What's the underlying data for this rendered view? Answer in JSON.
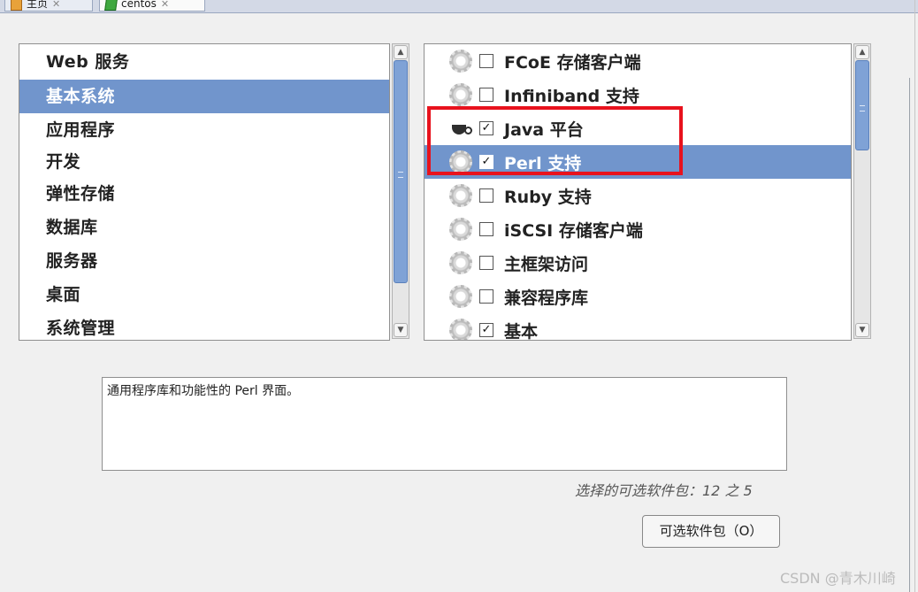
{
  "tabs": [
    {
      "label": "主页",
      "close": "✕"
    },
    {
      "label": "centos",
      "close": "✕"
    }
  ],
  "groups": [
    "Web 服务",
    "基本系统",
    "应用程序",
    "开发",
    "弹性存储",
    "数据库",
    "服务器",
    "桌面",
    "系统管理"
  ],
  "selected_group": "基本系统",
  "packages": [
    {
      "label": "FCoE 存储客户端",
      "checked": false,
      "icon": "gear-icon"
    },
    {
      "label": "Infiniband 支持",
      "checked": false,
      "icon": "gear-icon"
    },
    {
      "label": "Java 平台",
      "checked": true,
      "icon": "coffee-cup-icon"
    },
    {
      "label": "Perl 支持",
      "checked": true,
      "icon": "gear-icon",
      "selected": true
    },
    {
      "label": "Ruby 支持",
      "checked": false,
      "icon": "gear-icon"
    },
    {
      "label": "iSCSI 存储客户端",
      "checked": false,
      "icon": "gear-icon"
    },
    {
      "label": "主框架访问",
      "checked": false,
      "icon": "gear-icon"
    },
    {
      "label": "兼容程序库",
      "checked": false,
      "icon": "gear-icon"
    },
    {
      "label": "基本",
      "checked": true,
      "icon": "gear-icon"
    }
  ],
  "check_mark": "☑",
  "description": "通用程序库和功能性的 Perl 界面。",
  "optional_count": "选择的可选软件包：12 之 5",
  "optional_button": "可选软件包（O）",
  "watermark": "CSDN @青木川崎",
  "colors": {
    "selection": "#7195cc",
    "highlight_box": "#e8121d",
    "scroll_thumb": "#7fa2d6"
  }
}
